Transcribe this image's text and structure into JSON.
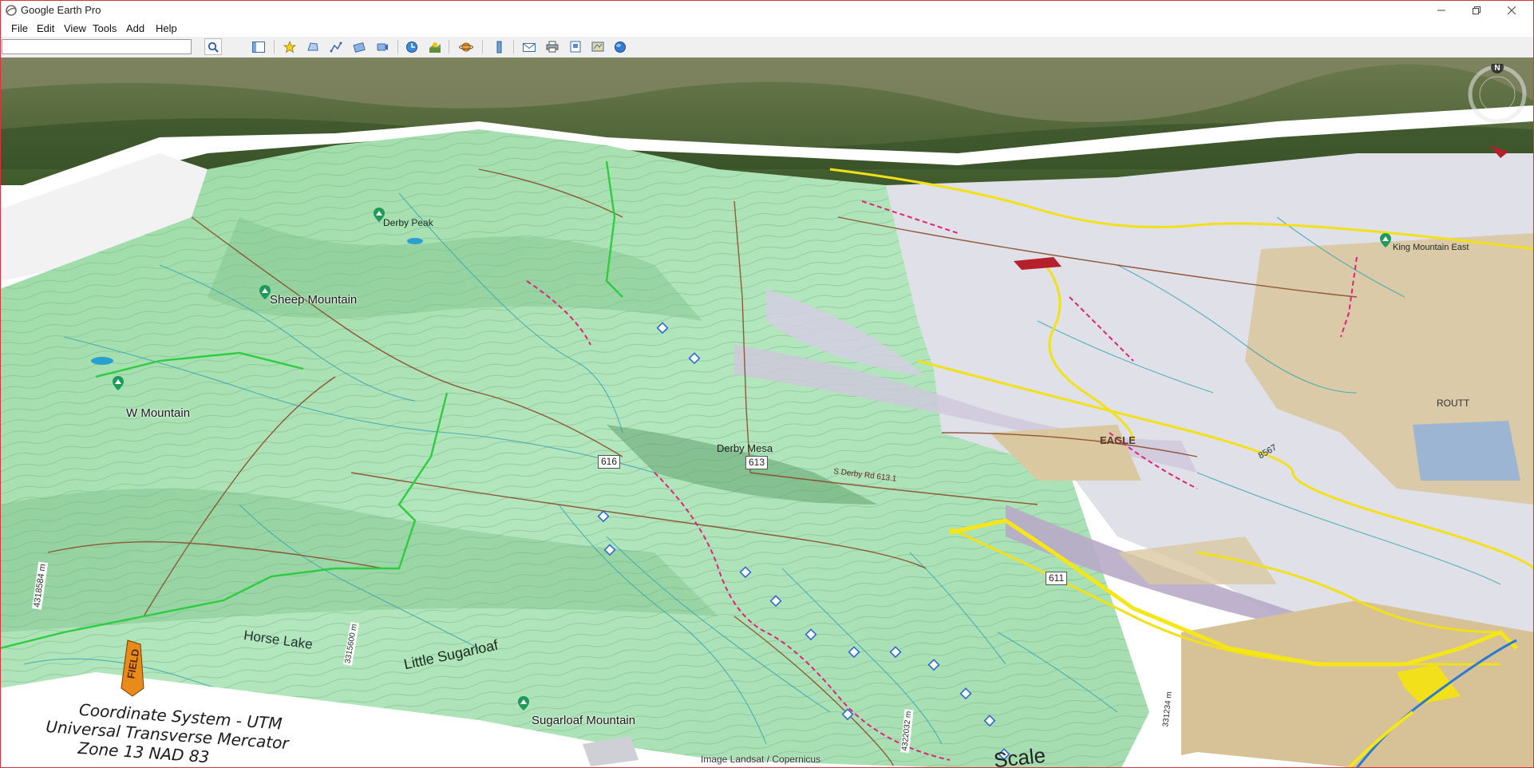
{
  "window": {
    "title": "Google Earth Pro"
  },
  "menu": {
    "items": [
      "File",
      "Edit",
      "View",
      "Tools",
      "Add",
      "Help"
    ]
  },
  "search": {
    "value": "",
    "placeholder": ""
  },
  "map": {
    "places": {
      "sheep_mountain": "Sheep Mountain",
      "w_mountain": "W Mountain",
      "sugarloaf_mountain": "Sugarloaf Mountain",
      "derby_peak": "Derby Peak",
      "king_mountain_east": "King Mountain East",
      "horse_lake": "Horse Lake",
      "little_sugarloaf": "Little Sugarloaf",
      "derby_mesa": "Derby Mesa",
      "eagle": "EAGLE",
      "routt": "ROUTT",
      "derby_rd": "S Derby Rd 613.1",
      "field": "FIELD"
    },
    "roads": {
      "r616": "616",
      "r613": "613",
      "r611": "611",
      "r8567": "8567"
    },
    "utm_labels": {
      "northing_left": "4318584 m",
      "easting_mid": "3315600 m",
      "northing_low": "4322032 m",
      "easting_right": "331234 m"
    },
    "coordinate_system": {
      "line1": "Coordinate System - UTM",
      "line2": "Universal Transverse Mercator",
      "line3": "Zone 13    NAD 83"
    },
    "scale_word": "Scale",
    "attribution": "Image Landsat / Copernicus",
    "compass_north": "N"
  },
  "colors": {
    "forest_green": "#a8e0b4",
    "blm_grey": "#dcdde6",
    "private_tan": "#d8c59e",
    "road_yellow": "#f2e11a",
    "trail_magenta": "#e0227a",
    "stream_teal": "#3aa7b3",
    "road_brown": "#8a4b2a"
  }
}
